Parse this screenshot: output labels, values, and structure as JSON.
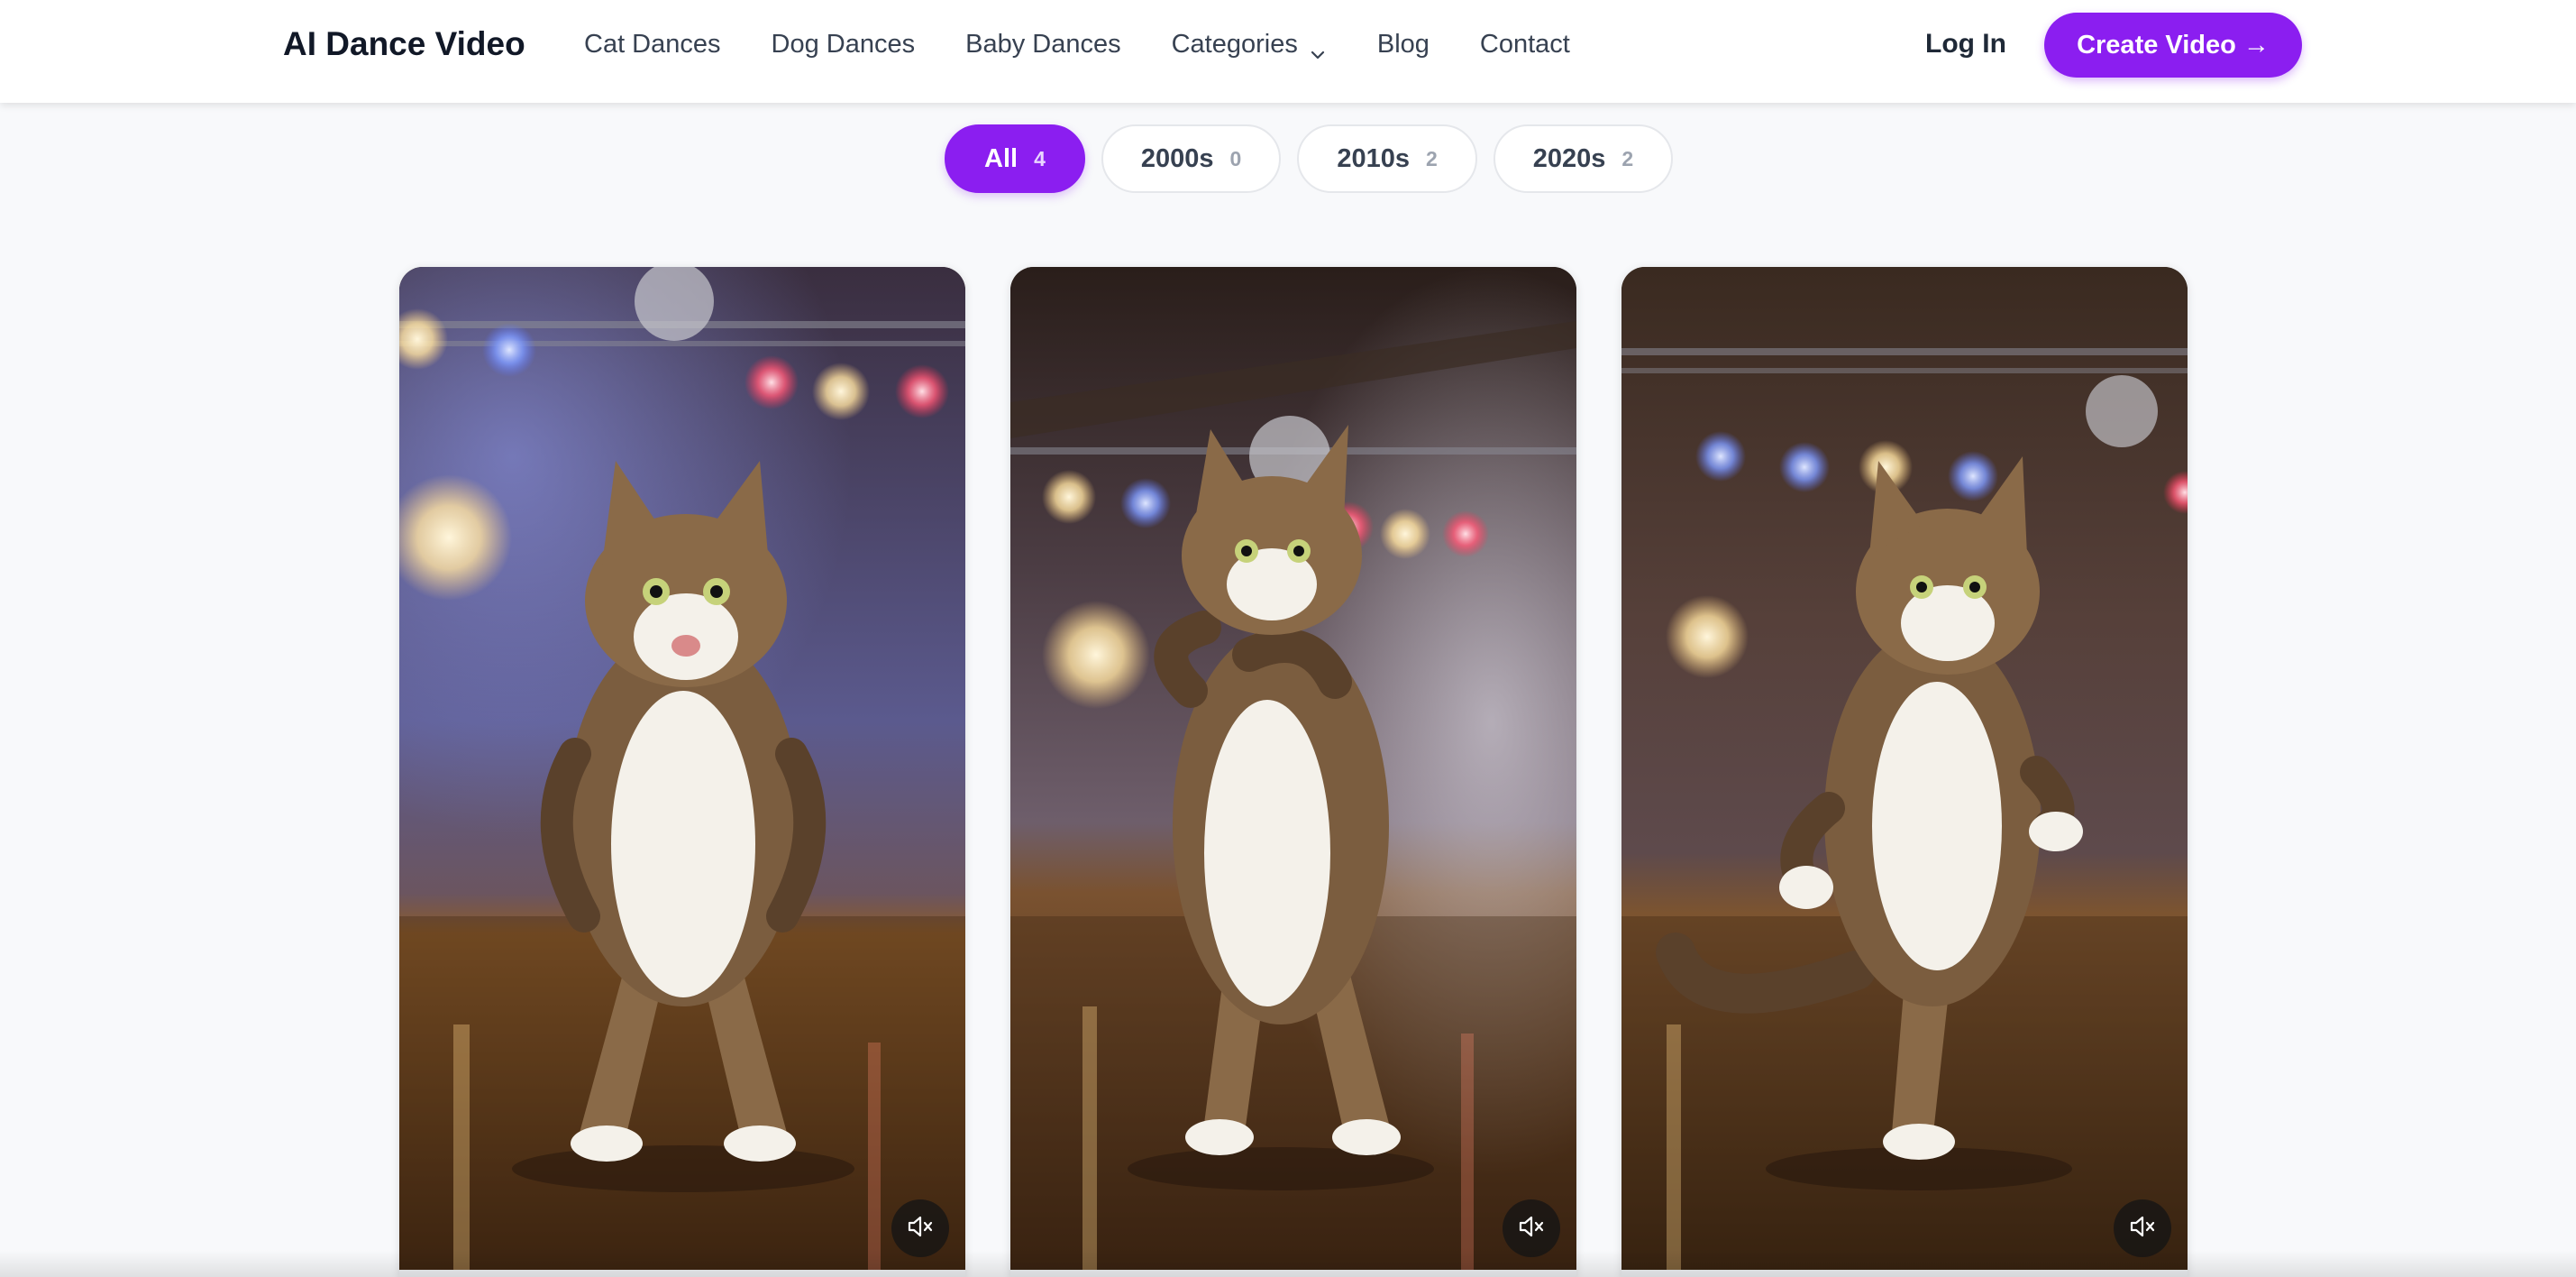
{
  "header": {
    "logo": "AI Dance Video",
    "nav": [
      "Cat Dances",
      "Dog Dances",
      "Baby Dances",
      "Categories",
      "Blog",
      "Contact"
    ],
    "login_label": "Log In",
    "create_label": "Create Video →"
  },
  "filters": [
    {
      "label": "All",
      "count": "4",
      "active": true
    },
    {
      "label": "2000s",
      "count": "0",
      "active": false
    },
    {
      "label": "2010s",
      "count": "2",
      "active": false
    },
    {
      "label": "2020s",
      "count": "2",
      "active": false
    }
  ],
  "videos": [
    {
      "subject": "dancing tabby cat on disco stage",
      "muted": true
    },
    {
      "subject": "dancing tabby cat on disco stage",
      "muted": true
    },
    {
      "subject": "dancing tabby cat on disco stage",
      "muted": true
    }
  ],
  "icons": {
    "chevron": "chevron-down-icon",
    "mute": "volume-mute-icon"
  },
  "colors": {
    "accent": "#8b1ef0",
    "background": "#f8f9fb"
  }
}
